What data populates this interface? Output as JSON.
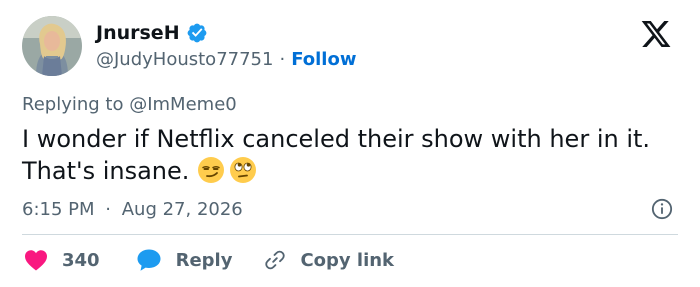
{
  "user": {
    "display_name": "JnurseH",
    "handle": "@JudyHousto77751",
    "separator": "·",
    "follow_label": "Follow",
    "avatar_icon": "profile-photo"
  },
  "tweet": {
    "replying_to_prefix": "Replying to",
    "replying_to_handle": "@ImMeme0",
    "text": "I wonder if Netflix canceled their show with her in it. That's insane.",
    "emojis": [
      "smirking-face",
      "face-with-rolling-eyes"
    ],
    "time": "6:15 PM",
    "date_separator": "·",
    "date": "Aug 27, 2026"
  },
  "actions": {
    "like_count": "340",
    "reply_label": "Reply",
    "copy_link_label": "Copy link"
  },
  "colors": {
    "verified_blue": "#1d9bf0",
    "like_red": "#f91880",
    "reply_blue": "#1d9bf0",
    "follow_blue": "#006fd6",
    "muted_text": "#536471"
  },
  "icons": [
    "x-logo-icon",
    "verified-badge-icon",
    "info-icon",
    "heart-icon",
    "reply-bubble-icon",
    "link-icon"
  ]
}
